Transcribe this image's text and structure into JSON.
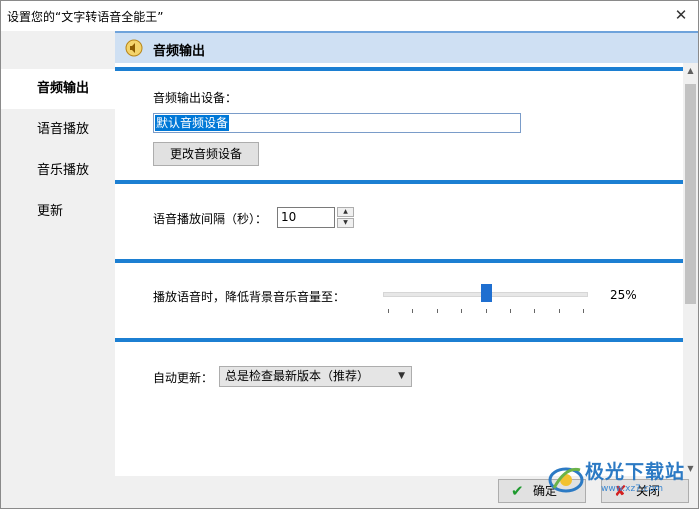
{
  "window": {
    "title": "设置您的“文字转语音全能王”",
    "close_glyph": "✕"
  },
  "sidebar": {
    "items": [
      {
        "label": "音频输出",
        "active": true
      },
      {
        "label": "语音播放",
        "active": false
      },
      {
        "label": "音乐播放",
        "active": false
      },
      {
        "label": "更新",
        "active": false
      }
    ]
  },
  "header": {
    "icon": "speaker-icon",
    "title": "音频输出"
  },
  "audio_output": {
    "device_label": "音频输出设备：",
    "device_value": "默认音频设备",
    "change_button": "更改音频设备"
  },
  "voice_playback": {
    "interval_label": "语音播放间隔（秒）：",
    "interval_value": "10"
  },
  "music_playback": {
    "label": "播放语音时，降低背景音乐音量至：",
    "percent_text": "25%",
    "level": 0.5
  },
  "update": {
    "label": "自动更新：",
    "selected": "总是检查最新版本（推荐）"
  },
  "footer": {
    "ok_label": "确定",
    "close_label": "关闭"
  },
  "watermark": {
    "text": "极光下载站",
    "sub": "www.xz7.com"
  },
  "colors": {
    "accent": "#1c7fd2",
    "header_bg": "#cfe0f3",
    "sidebar_bg": "#f0f0f0"
  }
}
